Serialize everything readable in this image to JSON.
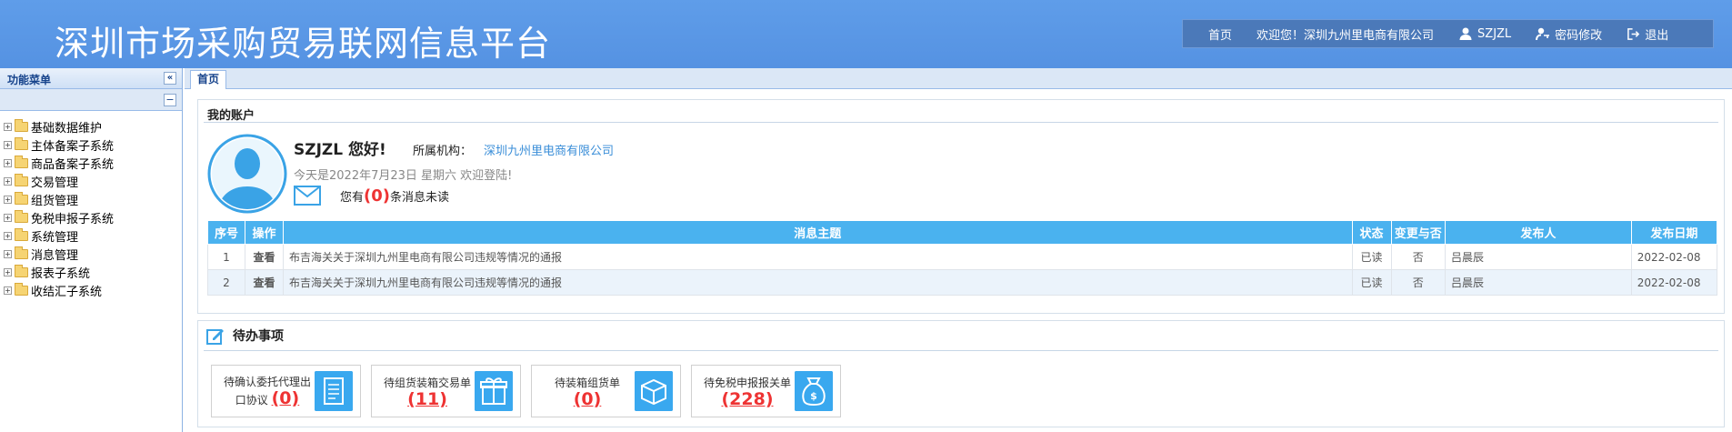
{
  "header": {
    "title": "深圳市场采购贸易联网信息平台",
    "nav": [
      {
        "label": "首页",
        "icon": ""
      },
      {
        "label": "欢迎您！深圳九州里电商有限公司",
        "icon": ""
      },
      {
        "label": "SZJZL",
        "icon": "user-icon"
      },
      {
        "label": "密码修改",
        "icon": "key-user-icon"
      },
      {
        "label": "退出",
        "icon": "logout-icon"
      }
    ]
  },
  "sidebar": {
    "title": "功能菜单",
    "items": [
      "基础数据维护",
      "主体备案子系统",
      "商品备案子系统",
      "交易管理",
      "组货管理",
      "免税申报子系统",
      "系统管理",
      "消息管理",
      "报表子系统",
      "收结汇子系统"
    ]
  },
  "tabs": [
    {
      "label": "首页"
    }
  ],
  "account": {
    "section_title": "我的账户",
    "greeting": "SZJZL 您好!",
    "org_label": "所属机构：",
    "org_name": "深圳九州里电商有限公司",
    "today": "今天是2022年7月23日 星期六 欢迎登陆!",
    "msg_prefix": "您有",
    "msg_count": "(0)",
    "msg_suffix": "条消息未读"
  },
  "messages": {
    "headers": [
      "序号",
      "操作",
      "消息主题",
      "状态",
      "变更与否",
      "发布人",
      "发布日期"
    ],
    "rows": [
      {
        "no": "1",
        "action": "查看",
        "subject": "布吉海关关于深圳九州里电商有限公司违规等情况的通报",
        "status": "已读",
        "changed": "否",
        "publisher": "吕晨辰",
        "date": "2022-02-08"
      },
      {
        "no": "2",
        "action": "查看",
        "subject": "布吉海关关于深圳九州里电商有限公司违规等情况的通报",
        "status": "已读",
        "changed": "否",
        "publisher": "吕晨辰",
        "date": "2022-02-08"
      }
    ]
  },
  "todo": {
    "section_title": "待办事项",
    "items": [
      {
        "label1": "待确认委托代理出",
        "label2": "口协议",
        "count": "(0)",
        "icon": "document-icon"
      },
      {
        "label1": "待组货装箱交易单",
        "label2": "",
        "count": "(11)",
        "icon": "gift-icon"
      },
      {
        "label1": "待装箱组货单",
        "label2": "",
        "count": "(0)",
        "icon": "box-icon"
      },
      {
        "label1": "待免税申报报关单",
        "label2": "",
        "count": "(228)",
        "icon": "money-bag-icon"
      }
    ]
  },
  "colors": {
    "header": "#5f9de9",
    "table_header": "#4ab2ef",
    "accent_red": "#e33333",
    "link_blue": "#3a8ed8"
  }
}
